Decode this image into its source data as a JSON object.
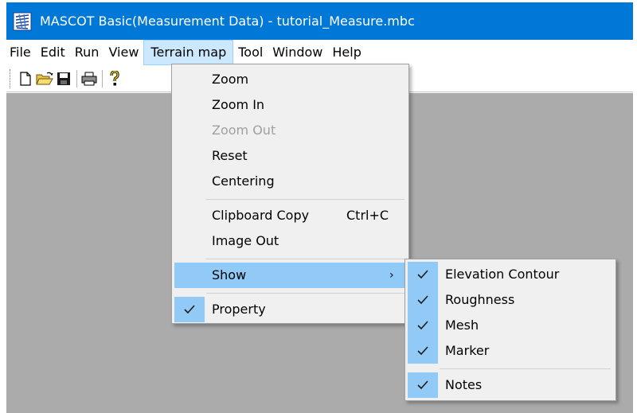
{
  "window": {
    "title": "MASCOT Basic(Measurement Data) - tutorial_Measure.mbc",
    "icon": "mascot-app-icon"
  },
  "menubar": {
    "file": "File",
    "edit": "Edit",
    "run": "Run",
    "view": "View",
    "terrain_map": "Terrain map",
    "tool": "Tool",
    "window": "Window",
    "help": "Help",
    "active": "Terrain map"
  },
  "toolbar": {
    "buttons": [
      "new-icon",
      "open-icon",
      "save-icon",
      "print-icon",
      "help-icon"
    ]
  },
  "terrain_menu": {
    "zoom": "Zoom",
    "zoom_in": "Zoom In",
    "zoom_out": "Zoom Out",
    "reset": "Reset",
    "centering": "Centering",
    "clipboard_copy": "Clipboard Copy",
    "clipboard_shortcut": "Ctrl+C",
    "image_out": "Image Out",
    "show": "Show",
    "property": "Property",
    "disabled": [
      "Zoom Out"
    ],
    "checked": [
      "Property"
    ]
  },
  "show_submenu": {
    "elevation_contour": "Elevation Contour",
    "roughness": "Roughness",
    "mesh": "Mesh",
    "marker": "Marker",
    "notes": "Notes",
    "checked": [
      "Elevation Contour",
      "Roughness",
      "Mesh",
      "Marker",
      "Notes"
    ]
  },
  "colors": {
    "titlebar": "#0078d7",
    "workspace": "#ababab",
    "menu_bg": "#f0f0f0",
    "highlight": "#91c9f7",
    "menubar_active": "#cce8ff"
  }
}
